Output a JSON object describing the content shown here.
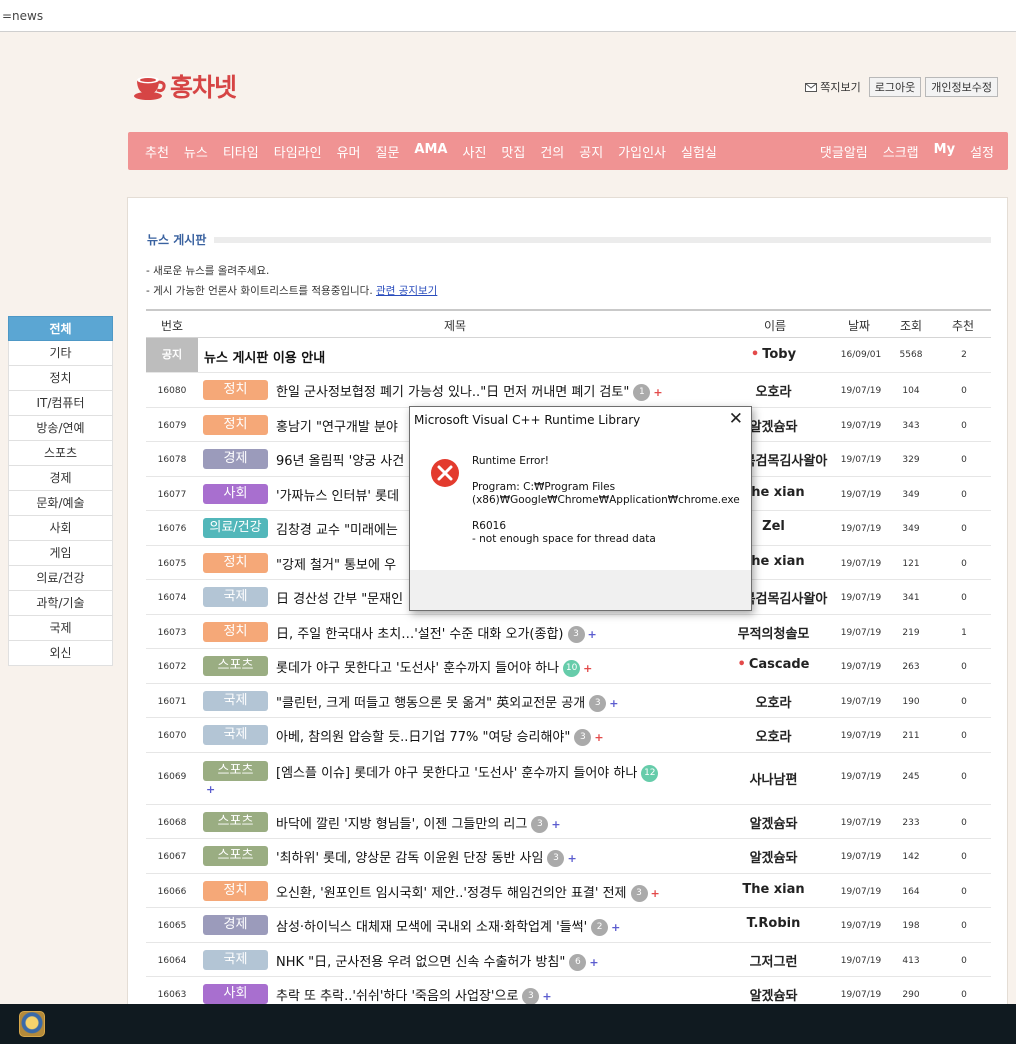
{
  "address_bar": {
    "text": "=news"
  },
  "logo": {
    "text": "홍차넷"
  },
  "top_links": {
    "memo": "쪽지보기",
    "logout": "로그아웃",
    "profile_edit": "개인정보수정"
  },
  "nav": {
    "left": [
      "추천",
      "뉴스",
      "티타임",
      "타임라인",
      "유머",
      "질문",
      "AMA",
      "사진",
      "맛집",
      "건의",
      "공지",
      "가입인사",
      "실험실"
    ],
    "right": [
      "댓글알림",
      "스크랩",
      "My",
      "설정"
    ]
  },
  "board": {
    "title": "뉴스 게시판",
    "notes": [
      "- 새로운 뉴스를 올려주세요.",
      "- 게시 가능한 언론사 화이트리스트를 적용중입니다."
    ],
    "notice_link": "관련 공지보기"
  },
  "sidebar": [
    "전체",
    "기타",
    "정치",
    "IT/컴퓨터",
    "방송/연예",
    "스포츠",
    "경제",
    "문화/예술",
    "사회",
    "게임",
    "의료/건강",
    "과학/기술",
    "국제",
    "외신"
  ],
  "table": {
    "headers": {
      "no": "번호",
      "title": "제목",
      "name": "이름",
      "date": "날짜",
      "views": "조회",
      "rec": "추천"
    },
    "notice": {
      "no": "공지",
      "title": "뉴스 게시판 이용 안내",
      "name": "Toby",
      "date": "16/09/01",
      "views": "5568",
      "rec": "2"
    },
    "rows": [
      {
        "no": "16080",
        "cat": "정치",
        "color": "#f5a878",
        "title": "한일 군사정보협정 폐기 가능성 있나..\"日 먼저 꺼내면 폐기 검토\"",
        "comments": "1",
        "plus": "red",
        "name": "오호라",
        "date": "19/07/19",
        "views": "104",
        "rec": "0"
      },
      {
        "no": "16079",
        "cat": "정치",
        "color": "#f5a878",
        "title": "홍남기 \"연구개발 분야",
        "comments": "",
        "plus": "",
        "name": "알겠슘돠",
        "date": "19/07/19",
        "views": "343",
        "rec": "0"
      },
      {
        "no": "16078",
        "cat": "경제",
        "color": "#9b9bbb",
        "title": "96년 올림픽 '양궁 사건",
        "comments": "",
        "plus": "",
        "name": "구밀복검목김사왈아",
        "date": "19/07/19",
        "views": "329",
        "rec": "0"
      },
      {
        "no": "16077",
        "cat": "사회",
        "color": "#a86fcf",
        "title": "'가짜뉴스 인터뷰' 롯데",
        "comments": "",
        "plus": "",
        "name": "The xian",
        "date": "19/07/19",
        "views": "349",
        "rec": "0"
      },
      {
        "no": "16076",
        "cat": "의료/건강",
        "color": "#52b7ba",
        "title": "김창경 교수 \"미래에는",
        "comments": "",
        "plus": "",
        "name": "Zel",
        "date": "19/07/19",
        "views": "349",
        "rec": "0"
      },
      {
        "no": "16075",
        "cat": "정치",
        "color": "#f5a878",
        "title": "\"강제 철거\" 통보에 우",
        "comments": "",
        "plus": "",
        "name": "The xian",
        "date": "19/07/19",
        "views": "121",
        "rec": "0"
      },
      {
        "no": "16074",
        "cat": "국제",
        "color": "#b3c5d5",
        "title": "日 경산성 간부 \"문재인",
        "comments": "",
        "plus": "",
        "name": "구밀복검목김사왈아",
        "date": "19/07/19",
        "views": "341",
        "rec": "0"
      },
      {
        "no": "16073",
        "cat": "정치",
        "color": "#f5a878",
        "title": "日, 주일 한국대사 초치…'설전' 수준 대화 오가(종합)",
        "comments": "3",
        "plus": "blue",
        "name": "무적의청솔모",
        "date": "19/07/19",
        "views": "219",
        "rec": "1"
      },
      {
        "no": "16072",
        "cat": "스포츠",
        "color": "#9aad82",
        "title": "롯데가 야구 못한다고 '도선사' 훈수까지 들어야 하나",
        "comments": "10",
        "green": true,
        "plus": "red",
        "name": "Cascade",
        "dot": true,
        "date": "19/07/19",
        "views": "263",
        "rec": "0"
      },
      {
        "no": "16071",
        "cat": "국제",
        "color": "#b3c5d5",
        "title": "\"클린턴, 크게 떠들고 행동으론 못 옮겨\" 英외교전문 공개",
        "comments": "3",
        "plus": "blue",
        "name": "오호라",
        "date": "19/07/19",
        "views": "190",
        "rec": "0"
      },
      {
        "no": "16070",
        "cat": "국제",
        "color": "#b3c5d5",
        "title": "아베, 참의원 압승할 듯..日기업 77% \"여당 승리해야\"",
        "comments": "3",
        "plus": "red",
        "name": "오호라",
        "date": "19/07/19",
        "views": "211",
        "rec": "0"
      },
      {
        "no": "16069",
        "cat": "스포츠",
        "color": "#9aad82",
        "title": "[엠스플 이슈] 롯데가 야구 못한다고 '도선사' 훈수까지 들어야 하나",
        "comments": "12",
        "green": true,
        "plus": "blue",
        "wrap": true,
        "name": "사나남편",
        "date": "19/07/19",
        "views": "245",
        "rec": "0"
      },
      {
        "no": "16068",
        "cat": "스포츠",
        "color": "#9aad82",
        "title": "바닥에 깔린 '지방 형님들', 이젠 그들만의 리그",
        "comments": "3",
        "plus": "blue",
        "name": "알겠슘돠",
        "date": "19/07/19",
        "views": "233",
        "rec": "0"
      },
      {
        "no": "16067",
        "cat": "스포츠",
        "color": "#9aad82",
        "title": "'최하위' 롯데, 양상문 감독 이윤원 단장 동반 사임",
        "comments": "3",
        "plus": "blue",
        "name": "알겠슘돠",
        "date": "19/07/19",
        "views": "142",
        "rec": "0"
      },
      {
        "no": "16066",
        "cat": "정치",
        "color": "#f5a878",
        "title": "오신환, '원포인트 임시국회' 제안..'정경두 해임건의안 표결' 전제",
        "comments": "3",
        "plus": "red",
        "name": "The xian",
        "date": "19/07/19",
        "views": "164",
        "rec": "0"
      },
      {
        "no": "16065",
        "cat": "경제",
        "color": "#9b9bbb",
        "title": "삼성·하이닉스 대체재 모색에 국내외 소재·화학업계 '들썩'",
        "comments": "2",
        "plus": "blue",
        "name": "T.Robin",
        "date": "19/07/19",
        "views": "198",
        "rec": "0"
      },
      {
        "no": "16064",
        "cat": "국제",
        "color": "#b3c5d5",
        "title": "NHK \"日, 군사전용 우려 없으면 신속 수출허가 방침\"",
        "comments": "6",
        "plus": "blue",
        "name": "그저그런",
        "date": "19/07/19",
        "views": "413",
        "rec": "0"
      },
      {
        "no": "16063",
        "cat": "사회",
        "color": "#a86fcf",
        "title": "추락 또 추락..'쉬쉬'하다 '죽음의 사업장'으로",
        "comments": "3",
        "plus": "blue",
        "name": "알겠슘돠",
        "date": "19/07/19",
        "views": "290",
        "rec": "0"
      }
    ]
  },
  "dialog": {
    "title": "Microsoft Visual C++ Runtime Library",
    "line1": "Runtime Error!",
    "line2": "Program: C:₩Program Files",
    "line3": "(x86)₩Google₩Chrome₩Application₩chrome.exe",
    "line4": "R6016",
    "line5": "- not enough space for thread data",
    "icon": "error-icon"
  },
  "taskbar": {
    "app_icon": "hearthstone-app-icon"
  }
}
